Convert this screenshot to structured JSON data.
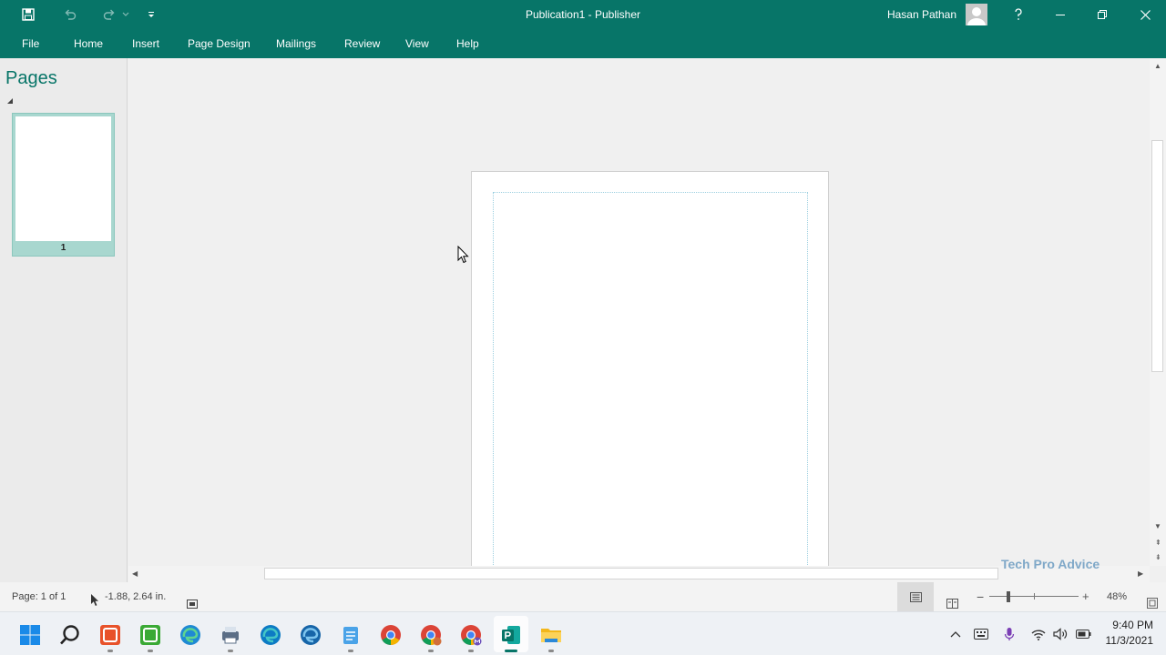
{
  "window": {
    "title": "Publication1  -  Publisher",
    "user_name": "Hasan Pathan"
  },
  "menu": {
    "file": "File",
    "tabs": [
      "Home",
      "Insert",
      "Page Design",
      "Mailings",
      "Review",
      "View",
      "Help"
    ]
  },
  "pages_pane": {
    "title": "Pages",
    "thumbnail_number": "1"
  },
  "statusbar": {
    "page_info": "Page: 1 of 1",
    "position": "-1.88, 2.64 in.",
    "zoom_level": "48%"
  },
  "watermark": "Tech Pro Advice",
  "clock": {
    "time": "9:40 PM",
    "date": "11/3/2021"
  },
  "colors": {
    "accent": "#077568",
    "thumbnail": "#a8d7cf"
  },
  "taskbar_icons": [
    "windows-start-icon",
    "search-icon",
    "app-orange-icon",
    "app-green-icon",
    "edge-icon",
    "printer-app-icon",
    "edge-dev-icon",
    "edge-beta-icon",
    "notepad-icon",
    "chrome-icon",
    "chrome-profile-icon",
    "chrome-profile-m-icon",
    "publisher-icon",
    "file-explorer-icon"
  ]
}
